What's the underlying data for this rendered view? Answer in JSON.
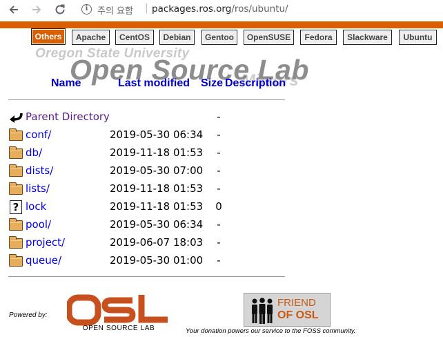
{
  "browser": {
    "security_text": "주의 요함",
    "url_host": "packages.ros.org",
    "url_path": "/ros/ubuntu/"
  },
  "colors": {
    "osu_orange": "#d95f02",
    "link": "#0000ee",
    "visited_link": "#551a8b"
  },
  "tabs": [
    {
      "label": "Others",
      "active": true
    },
    {
      "label": "Apache",
      "active": false
    },
    {
      "label": "CentOS",
      "active": false
    },
    {
      "label": "Debian",
      "active": false
    },
    {
      "label": "Gentoo",
      "active": false
    },
    {
      "label": "OpenSUSE",
      "active": false
    },
    {
      "label": "Fedora",
      "active": false
    },
    {
      "label": "Slackware",
      "active": false
    },
    {
      "label": "Ubuntu",
      "active": false
    }
  ],
  "header": {
    "university": "Oregon State University",
    "lab": "Open Source Lab",
    "section": "Mirrors"
  },
  "columns": {
    "name": "Name",
    "modified": "Last modified",
    "size": "Size",
    "description": "Description"
  },
  "listing": [
    {
      "name": "Parent Directory",
      "date": "",
      "size": "-",
      "icon": "back-arrow-icon",
      "visited": true
    },
    {
      "name": "conf/",
      "date": "2019-05-30 06:34",
      "size": "-",
      "icon": "folder-icon",
      "visited": false
    },
    {
      "name": "db/",
      "date": "2019-11-18 01:53",
      "size": "-",
      "icon": "folder-icon",
      "visited": false
    },
    {
      "name": "dists/",
      "date": "2019-05-30 07:00",
      "size": "-",
      "icon": "folder-icon",
      "visited": false
    },
    {
      "name": "lists/",
      "date": "2019-11-18 01:53",
      "size": "-",
      "icon": "folder-icon",
      "visited": false
    },
    {
      "name": "lock",
      "date": "2019-11-18 01:53",
      "size": "0",
      "icon": "unknown-file-icon",
      "visited": false
    },
    {
      "name": "pool/",
      "date": "2019-05-30 06:34",
      "size": "-",
      "icon": "folder-icon",
      "visited": false
    },
    {
      "name": "project/",
      "date": "2019-06-07 18:03",
      "size": "-",
      "icon": "folder-icon",
      "visited": false
    },
    {
      "name": "queue/",
      "date": "2019-05-30 01:00",
      "size": "-",
      "icon": "folder-icon",
      "visited": false
    }
  ],
  "footer": {
    "powered_by": "Powered by:",
    "osl_logo": "OSL",
    "osl_subtitle": "OPEN SOURCE LAB",
    "friend_line1": "FRIEND",
    "friend_line2": "OF OSL",
    "donation": "Your donation powers our service to the FOSS community."
  }
}
